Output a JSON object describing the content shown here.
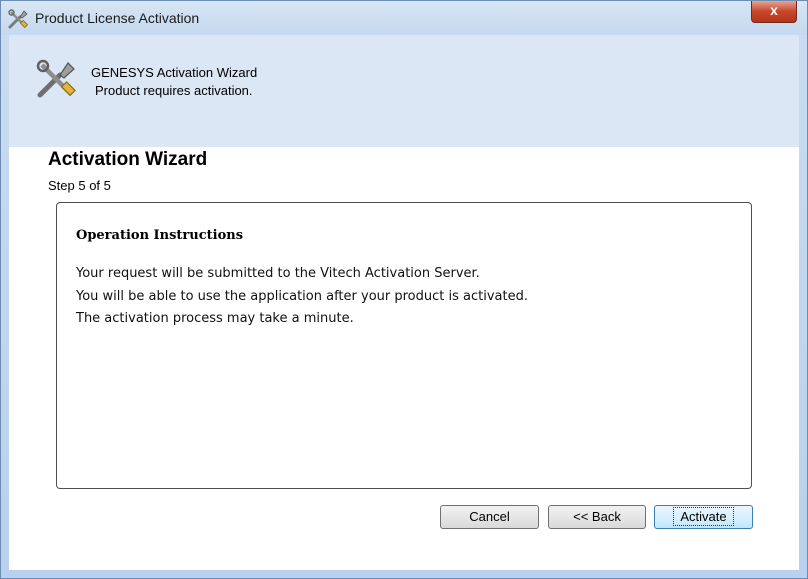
{
  "window": {
    "title": "Product License Activation",
    "close_label": "x",
    "title_icon": "tools-icon"
  },
  "header": {
    "icon": "tools-icon",
    "title": "GENESYS Activation Wizard",
    "subtitle": "Product requires activation."
  },
  "wizard": {
    "title": "Activation Wizard",
    "step": "Step 5 of 5"
  },
  "instructions": {
    "heading": "Operation Instructions",
    "lines": [
      "Your request will be submitted to the Vitech Activation Server.",
      "You will be able to use the application after your product is activated.",
      "The activation process may take a minute."
    ]
  },
  "buttons": {
    "cancel": "Cancel",
    "back": "<< Back",
    "activate": "Activate"
  },
  "colors": {
    "header_band": "#dbe7f4",
    "frame": "#b9d1ec",
    "close_button": "#c8462a",
    "default_button_border": "#3c7fb1"
  }
}
